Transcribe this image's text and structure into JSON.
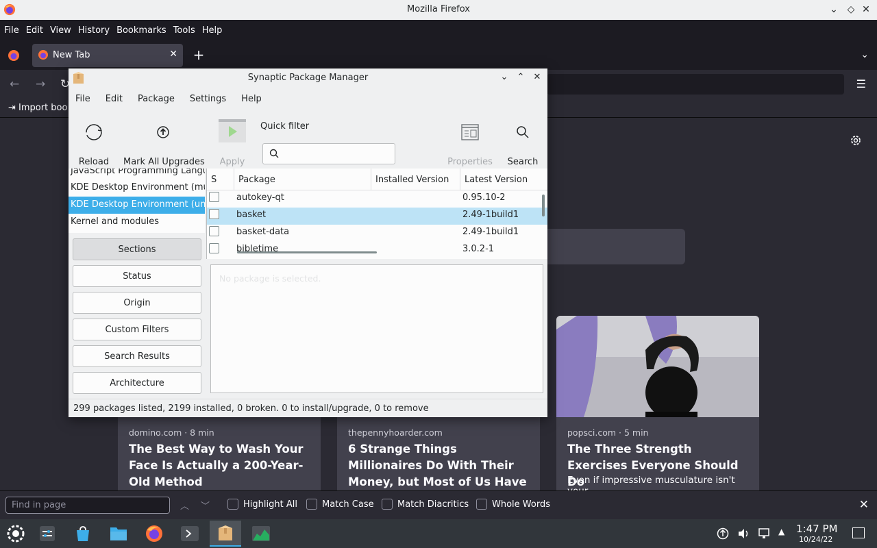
{
  "firefox": {
    "window_title": "Mozilla Firefox",
    "menu": [
      "File",
      "Edit",
      "View",
      "History",
      "Bookmarks",
      "Tools",
      "Help"
    ],
    "tab": {
      "label": "New Tab"
    },
    "bookmarks": {
      "import_label": "Import boo"
    },
    "stories": [
      {
        "source": "domino.com · 8 min",
        "title": "The Best Way to Wash Your Face Is Actually a 200-Year-Old Method",
        "excerpt": ""
      },
      {
        "source": "thepennyhoarder.com",
        "title": "6 Strange Things Millionaires Do With Their Money, but Most of Us Have Never Tried",
        "excerpt": ""
      },
      {
        "source": "popsci.com · 5 min",
        "title": "The Three Strength Exercises Everyone Should Do",
        "excerpt": "Even if impressive musculature isn't your"
      }
    ],
    "findbar": {
      "placeholder": "Find in page",
      "options": [
        "Highlight All",
        "Match Case",
        "Match Diacritics",
        "Whole Words"
      ]
    }
  },
  "synaptic": {
    "window_title": "Synaptic Package Manager",
    "menu": [
      "File",
      "Edit",
      "Package",
      "Settings",
      "Help"
    ],
    "toolbar": {
      "reload": "Reload",
      "mark_all_upgrades": "Mark All Upgrades",
      "apply": "Apply",
      "quick_filter": "Quick filter",
      "properties": "Properties",
      "search": "Search"
    },
    "sections": [
      "JavaScript Programming Language",
      "KDE Desktop Environment (multiverse)",
      "KDE Desktop Environment (universe)",
      "Kernel and modules"
    ],
    "filter_buttons": [
      "Sections",
      "Status",
      "Origin",
      "Custom Filters",
      "Search Results",
      "Architecture"
    ],
    "columns": {
      "s": "S",
      "package": "Package",
      "installed": "Installed Version",
      "latest": "Latest Version"
    },
    "packages": [
      {
        "name": "autokey-qt",
        "installed": "",
        "latest": "0.95.10-2"
      },
      {
        "name": "basket",
        "installed": "",
        "latest": "2.49-1build1"
      },
      {
        "name": "basket-data",
        "installed": "",
        "latest": "2.49-1build1"
      },
      {
        "name": "bibletime",
        "installed": "",
        "latest": "3.0.2-1"
      }
    ],
    "description_placeholder": "No package is selected.",
    "status_text": "299 packages listed, 2199 installed, 0 broken. 0 to install/upgrade, 0 to remove"
  },
  "taskbar": {
    "time": "1:47 PM",
    "date": "10/24/22"
  },
  "colors": {
    "accent": "#3daee9",
    "firefox_dark": "#2b2a33",
    "selected_row": "#bde3f6"
  }
}
